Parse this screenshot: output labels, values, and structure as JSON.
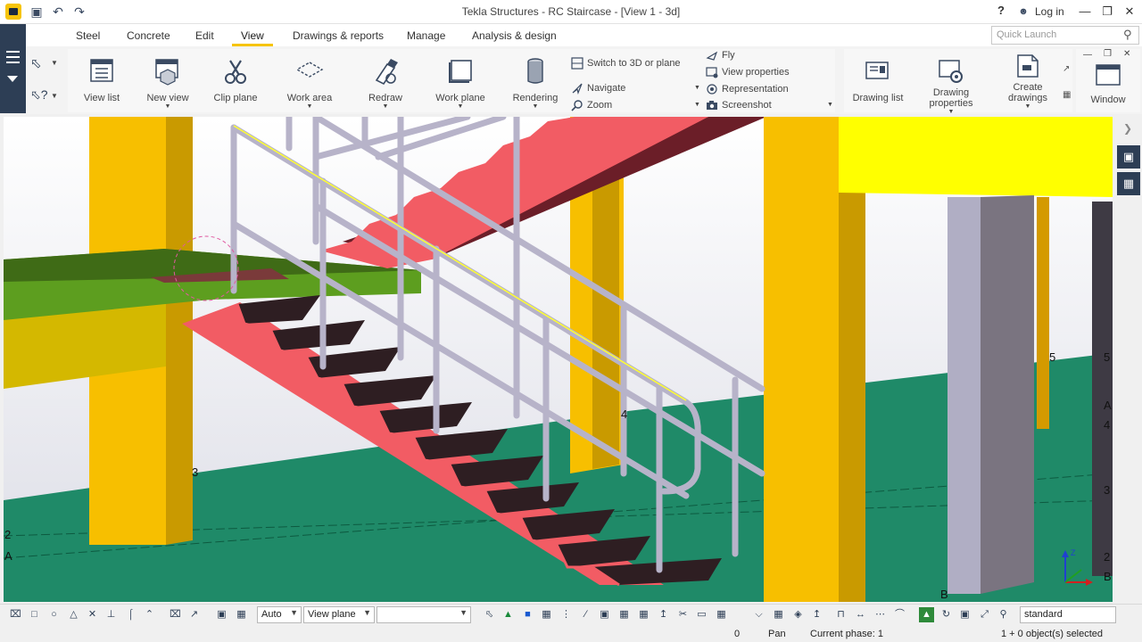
{
  "window": {
    "title": "Tekla Structures - RC Staircase - [View 1 - 3d]",
    "help_label": "?",
    "login_label": "Log in",
    "controls": [
      "—",
      "❐",
      "✕"
    ]
  },
  "tabs": [
    "Steel",
    "Concrete",
    "Edit",
    "View",
    "Drawings & reports",
    "Manage",
    "Analysis & design"
  ],
  "active_tab": "View",
  "quick_launch": {
    "placeholder": "Quick Launch"
  },
  "ribbon": {
    "view_list": "View list",
    "new_view": "New view",
    "clip_plane": "Clip plane",
    "work_area": "Work area",
    "redraw": "Redraw",
    "work_plane": "Work plane",
    "rendering": "Rendering",
    "switch_3d": "Switch to 3D or plane",
    "navigate": "Navigate",
    "zoom": "Zoom",
    "fly": "Fly",
    "view_properties": "View properties",
    "representation": "Representation",
    "screenshot": "Screenshot",
    "drawing_list": "Drawing list",
    "drawing_properties_1": "Drawing",
    "drawing_properties_2": "properties",
    "create_drawings_1": "Create",
    "create_drawings_2": "drawings",
    "window": "Window"
  },
  "viewport": {
    "grid_labels": {
      "n3": "3",
      "n2": "2",
      "nA": "A",
      "n4": "4",
      "r5a": "5",
      "r5b": "5",
      "rA": "A",
      "r4": "4",
      "r3": "3",
      "r2": "2",
      "rB": "B",
      "bB": "B"
    },
    "axis": {
      "x": "X",
      "y": "Y",
      "z": "Z"
    }
  },
  "bottom_toolbar": {
    "select_auto": "Auto",
    "select_plane": "View plane",
    "select_empty": "",
    "standard_field": "standard"
  },
  "status": {
    "count": "0",
    "mode": "Pan",
    "phase": "Current phase: 1",
    "selection": "1 + 0 object(s) selected"
  }
}
